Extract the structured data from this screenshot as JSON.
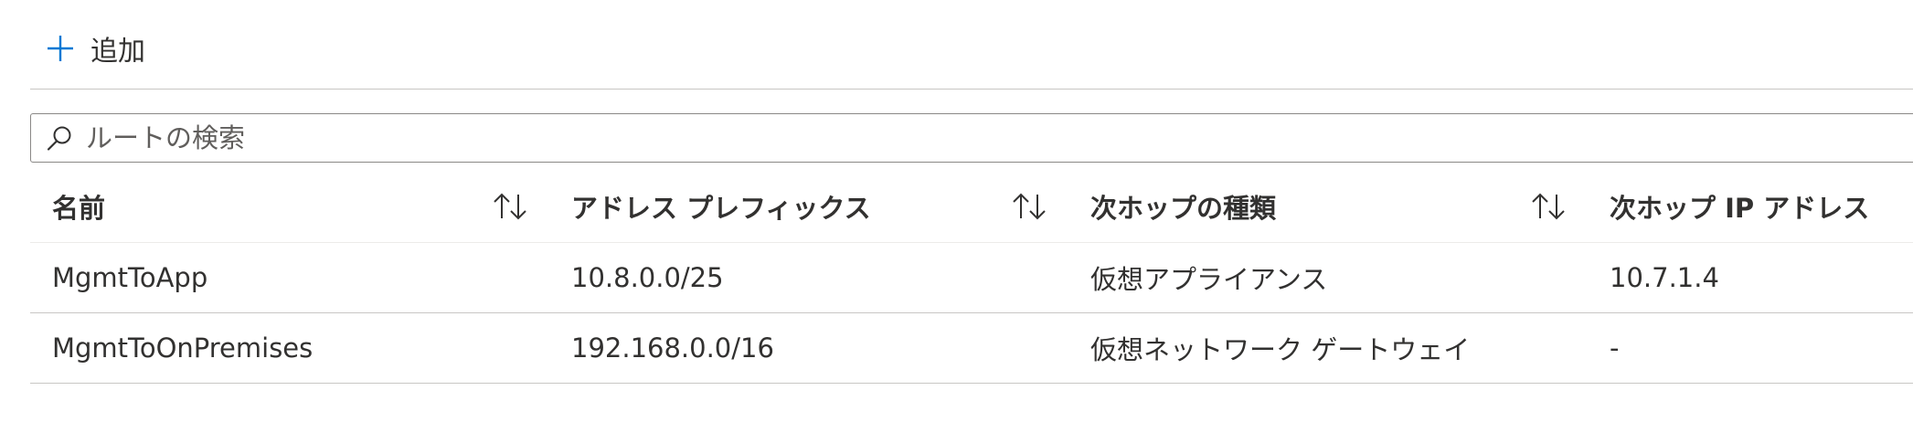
{
  "toolbar": {
    "add_label": "追加"
  },
  "search": {
    "placeholder": "ルートの検索",
    "value": ""
  },
  "table": {
    "columns": [
      "名前",
      "アドレス プレフィックス",
      "次ホップの種類",
      "次ホップ IP アドレス"
    ],
    "rows": [
      [
        "MgmtToApp",
        "10.8.0.0/25",
        "仮想アプライアンス",
        "10.7.1.4"
      ],
      [
        "MgmtToOnPremises",
        "192.168.0.0/16",
        "仮想ネットワーク ゲートウェイ",
        "-"
      ]
    ]
  },
  "colors": {
    "accent": "#0078d4",
    "text": "#323130",
    "border": "#c8c6c4"
  },
  "icons": {
    "add": "plus-icon",
    "search": "search-icon",
    "sort": "sort-updown-icon"
  }
}
